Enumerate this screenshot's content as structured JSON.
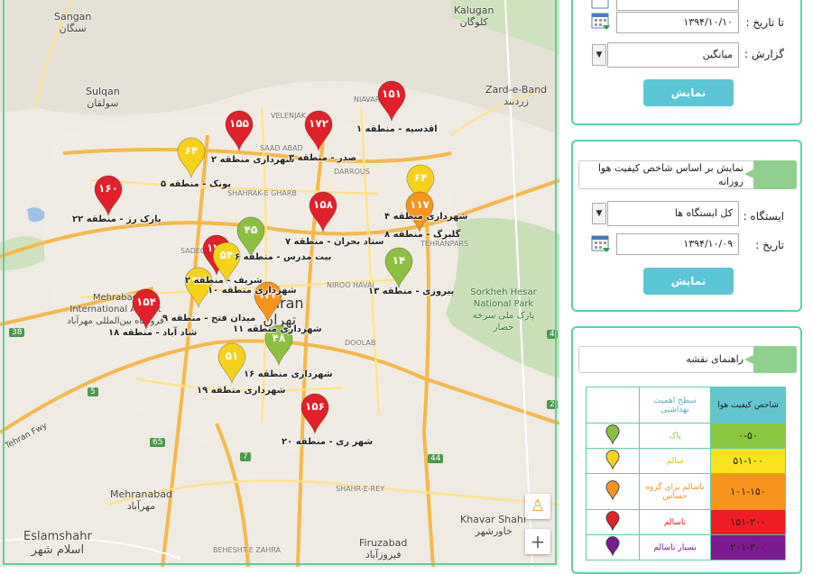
{
  "map": {
    "places": [
      {
        "en": "Sangan",
        "fa": "سنگان"
      },
      {
        "en": "Kalugan",
        "fa": "کلوگان"
      },
      {
        "en": "Sulqan",
        "fa": "سولقان"
      },
      {
        "en": "Zard-e-Band",
        "fa": "زردبند"
      },
      {
        "en": "Tehran",
        "fa": "تهران"
      },
      {
        "en": "Mehrabad International Airport",
        "fa": "فرودگاه بین‌المللی مهرآباد"
      },
      {
        "en": "Sorkheh Hesar National Park",
        "fa": "پارک ملی سرخه حصار"
      },
      {
        "en": "Mehranabad",
        "fa": "مهرآباد"
      },
      {
        "en": "Eslamshahr",
        "fa": "اسلام شهر"
      },
      {
        "en": "Khavar Shahr",
        "fa": "خاورشهر"
      },
      {
        "en": "Firuzabad",
        "fa": "فیروزآباد"
      },
      {
        "en": "Tehran Fwy",
        "fa": ""
      }
    ],
    "districts": [
      "NIAVARAN",
      "VELENJAK",
      "SAAD ABAD",
      "DARROUS",
      "SHAHRAK-E GHARB",
      "SADEGHIYEH",
      "NIROO HAVAI",
      "TEHRANPARS",
      "DOOLAB",
      "SHAHR-E-REY",
      "BEHESHT-E ZAHRA"
    ],
    "roads": [
      "38",
      "5",
      "65",
      "7",
      "44",
      "4",
      "2"
    ],
    "stations": [
      {
        "value": "۱۵۱",
        "label": "اقدسیه - منطقه ۱",
        "level": "red"
      },
      {
        "value": "۱۵۵",
        "label": "شهرداری منطقه ۲",
        "level": "red"
      },
      {
        "value": "۱۷۲",
        "label": "صدر - منطقه ۳",
        "level": "red"
      },
      {
        "value": "۶۴",
        "label": "پونک - منطقه ۵",
        "level": "yellow"
      },
      {
        "value": "۶۴",
        "label": "شهرداری منطقه ۴",
        "level": "yellow"
      },
      {
        "value": "۱۱۷",
        "label": "گلبرگ - منطقه ۸",
        "level": "orange"
      },
      {
        "value": "۱۶۰",
        "label": "پارک رز - منطقه ۲۲",
        "level": "red"
      },
      {
        "value": "۱۵۸",
        "label": "ستاد بحران - منطقه ۷",
        "level": "red"
      },
      {
        "value": "۴۵",
        "label": "بیت مدرس - منطقه ۶",
        "level": "green"
      },
      {
        "value": "۱۲۰",
        "label": "شریف - منطقه ۲",
        "level": "red"
      },
      {
        "value": "۵۴",
        "label": "شهرداری منطقه ۱۰",
        "level": "yellow"
      },
      {
        "value": "۱۴",
        "label": "پیروزی - منطقه ۱۳",
        "level": "green"
      },
      {
        "value": "۹۴",
        "label": "میدان فتح - منطقه ۹",
        "level": "yellow"
      },
      {
        "value": "۱۵۴",
        "label": "شاد آباد - منطقه ۱۸",
        "level": "red"
      },
      {
        "value": "۱۴۳",
        "label": "شهرداری منطقه ۱۱",
        "level": "orange"
      },
      {
        "value": "۴۸",
        "label": "شهرداری منطقه ۱۶",
        "level": "green"
      },
      {
        "value": "۵۱",
        "label": "شهرداری منطقه ۱۹",
        "level": "yellow"
      },
      {
        "value": "۱۵۶",
        "label": "شهر ری - منطقه ۲۰",
        "level": "red"
      }
    ],
    "zoom_in": "+"
  },
  "form1": {
    "to_date_label": "تا تاریخ :",
    "to_date_value": "۱۳۹۴/۱۰/۱۰",
    "report_label": "گزارش :",
    "report_value": "میانگین",
    "show_button": "نمایش"
  },
  "form2": {
    "title": "نمایش بر اساس شاخص کیفیت هوا روزانه",
    "station_label": "ایستگاه :",
    "station_value": "کل ایستگاه ها",
    "date_label": "تاریخ :",
    "date_value": "۱۳۹۴/۱۰/۰۹",
    "show_button": "نمایش"
  },
  "legend": {
    "title": "راهنمای نقشه",
    "col_index": "شاخص کیفیت هوا",
    "col_level": "سطح اهمیت بهداشتی",
    "rows": [
      {
        "range": "۰-۵۰",
        "text": "پاک",
        "bg": "#8cc63f",
        "fg": "#8cc63f",
        "pin": "#8dc040"
      },
      {
        "range": "۵۱-۱۰۰",
        "text": "سالم",
        "bg": "#f9e31c",
        "fg": "#e0c000",
        "pin": "#f7d21b"
      },
      {
        "range": "۱۰۱-۱۵۰",
        "text": "ناسالم برای گروه حساس",
        "bg": "#f7941d",
        "fg": "#f7941d",
        "pin": "#f7941d"
      },
      {
        "range": "۱۵۱-۲۰۰",
        "text": "ناسالم",
        "bg": "#ee1c25",
        "fg": "#ee1c25",
        "pin": "#e2202a"
      },
      {
        "range": "۲۰۱-۳۰۰",
        "text": "بسیار ناسالم",
        "bg": "#7b1a91",
        "fg": "#7b1a91",
        "pin": "#7b1a91"
      }
    ]
  },
  "colors": {
    "red": "#e2202a",
    "orange": "#f7941d",
    "yellow": "#f7d21b",
    "green": "#8dc040",
    "accent": "#5fcfa5",
    "button": "#5bc6d6"
  }
}
